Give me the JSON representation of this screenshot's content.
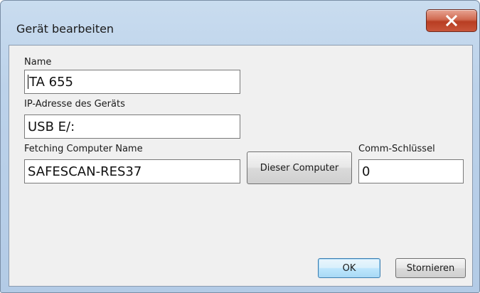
{
  "window": {
    "title": "Gerät bearbeiten"
  },
  "fields": {
    "name": {
      "label": "Name",
      "value": "TA 655"
    },
    "ip": {
      "label": "IP-Adresse des Geräts",
      "value": "USB E/:"
    },
    "computer_name": {
      "label": "Fetching Computer Name",
      "value": "SAFESCAN-RES37"
    },
    "comm_key": {
      "label": "Comm-Schlüssel",
      "value": "0"
    }
  },
  "buttons": {
    "this_computer": "Dieser Computer",
    "ok": "OK",
    "cancel": "Stornieren"
  },
  "icons": {
    "close": "close-icon"
  },
  "colors": {
    "close_button": "#c8553a",
    "dialog_background": "#f0f0f0",
    "frame": "#bcd2ea",
    "default_button_border": "#3c7fb1"
  }
}
